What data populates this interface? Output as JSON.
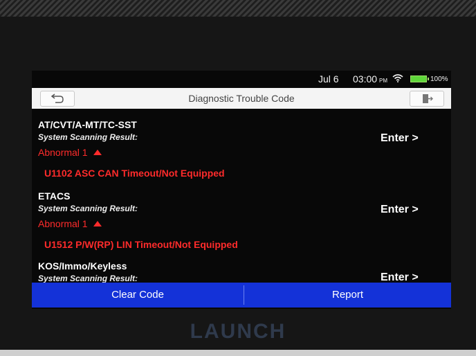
{
  "status_bar": {
    "date": "Jul 6",
    "time": "03:00",
    "ampm": "PM",
    "battery": "100%",
    "wifi_icon": "wifi-icon",
    "battery_icon": "battery-icon"
  },
  "header": {
    "title": "Diagnostic Trouble Code",
    "back_icon": "back-arrow-icon",
    "exit_icon": "exit-door-icon"
  },
  "systems": [
    {
      "name": "AT/CVT/A-MT/TC-SST",
      "scan_label": "System Scanning Result:",
      "status": "Abnormal 1",
      "dtc": "U1102 ASC CAN Timeout/Not Equipped",
      "enter": "Enter >"
    },
    {
      "name": "ETACS",
      "scan_label": "System Scanning Result:",
      "status": "Abnormal 1",
      "dtc": "U1512 P/W(RP) LIN Timeout/Not Equipped",
      "enter": "Enter >"
    },
    {
      "name": "KOS/Immo/Keyless",
      "scan_label": "System Scanning Result:",
      "enter": "Enter >"
    }
  ],
  "actions": {
    "clear_code": "Clear Code",
    "report": "Report"
  },
  "brand": "LAUNCH",
  "colors": {
    "action_bar": "#1432d8",
    "error_red": "#ff2b2b",
    "battery_green": "#5ed63a"
  }
}
